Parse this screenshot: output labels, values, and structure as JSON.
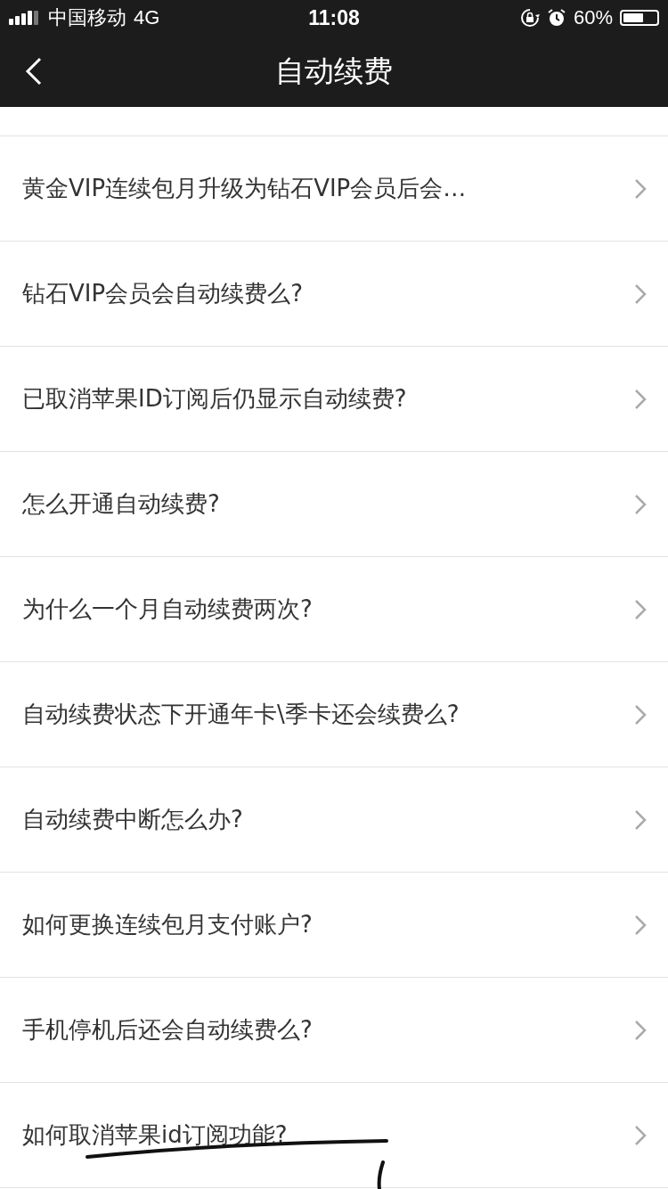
{
  "status_bar": {
    "carrier": "中国移动",
    "network": "4G",
    "time": "11:08",
    "battery": "60%"
  },
  "nav_bar": {
    "title": "自动续费"
  },
  "items": [
    {
      "label": "黄金VIP连续包月升级为钻石VIP会员后会…"
    },
    {
      "label": "钻石VIP会员会自动续费么?"
    },
    {
      "label": "已取消苹果ID订阅后仍显示自动续费?"
    },
    {
      "label": "怎么开通自动续费?"
    },
    {
      "label": "为什么一个月自动续费两次?"
    },
    {
      "label": "自动续费状态下开通年卡\\季卡还会续费么?"
    },
    {
      "label": "自动续费中断怎么办?"
    },
    {
      "label": "如何更换连续包月支付账户?"
    },
    {
      "label": "手机停机后还会自动续费么?"
    },
    {
      "label": "如何取消苹果id订阅功能?"
    }
  ]
}
